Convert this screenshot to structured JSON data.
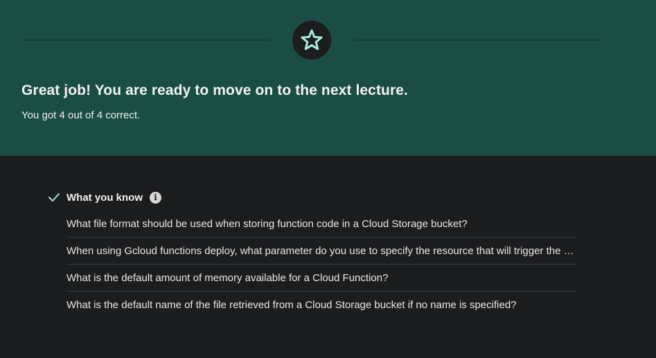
{
  "banner": {
    "headline": "Great job! You are ready to move on to the next lecture.",
    "score_text": "You got 4 out of 4 correct.",
    "background_color": "#1a4d44",
    "star_color": "#a8ecd8",
    "icon": "star-icon"
  },
  "section": {
    "title": "What you know",
    "check_icon": "check-icon",
    "info_icon": "info-icon",
    "check_color": "#a8ecd8"
  },
  "questions": [
    "What file format should be used when storing function code in a Cloud Storage bucket?",
    "When using Gcloud functions deploy, what parameter do you use to specify the resource that will trigger the function?",
    "What is the default amount of memory available for a Cloud Function?",
    "What is the default name of the file retrieved from a Cloud Storage bucket if no name is specified?"
  ]
}
